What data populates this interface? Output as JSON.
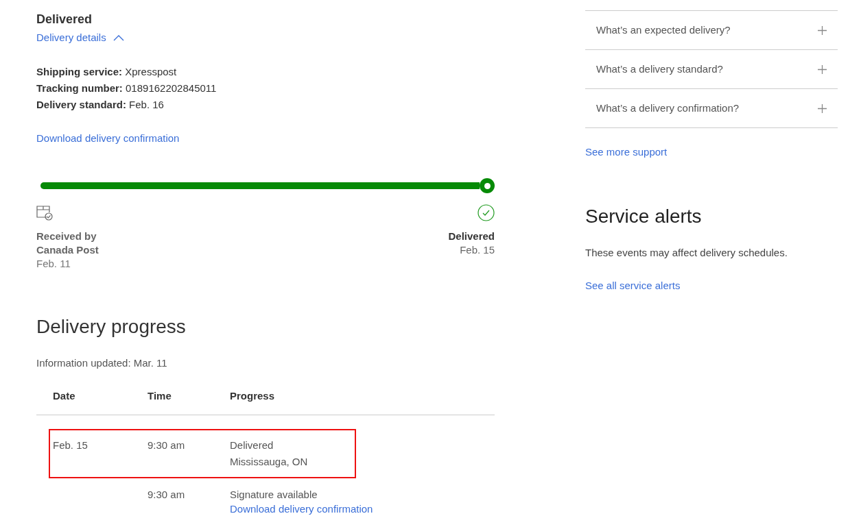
{
  "status": {
    "title": "Delivered",
    "details_toggle": "Delivery details",
    "expanded": true
  },
  "details": [
    {
      "label": "Shipping service:",
      "value": "Xpresspost"
    },
    {
      "label": "Tracking number:",
      "value": "0189162202845011"
    },
    {
      "label": "Delivery standard:",
      "value": "Feb. 16"
    }
  ],
  "download_link": "Download delivery confirmation",
  "tracker": {
    "level": 1,
    "start": {
      "title": "Received by Canada Post",
      "date": "Feb. 11"
    },
    "end": {
      "title": "Delivered",
      "date": "Feb. 15"
    }
  },
  "progress": {
    "title": "Delivery progress",
    "updated": "Information updated: Mar. 11",
    "columns": [
      "Date",
      "Time",
      "Progress"
    ],
    "rows": [
      {
        "date": "Feb. 15",
        "time": "9:30 am",
        "lines": [
          "Delivered",
          "Mississauga, ON"
        ],
        "highlighted": true
      },
      {
        "time": "9:30 am",
        "lines": [
          "Signature available"
        ],
        "link": "Download delivery confirmation",
        "highlighted": false
      }
    ]
  },
  "faq": [
    {
      "question": "What’s an expected delivery?",
      "expanded": false
    },
    {
      "question": "What’s a delivery standard?",
      "expanded": false
    },
    {
      "question": "What’s a delivery confirmation?",
      "expanded": false
    }
  ],
  "support_link": "See more support",
  "alerts": {
    "title": "Service alerts",
    "text": "These events may affect delivery schedules.",
    "link": "See all service alerts"
  }
}
